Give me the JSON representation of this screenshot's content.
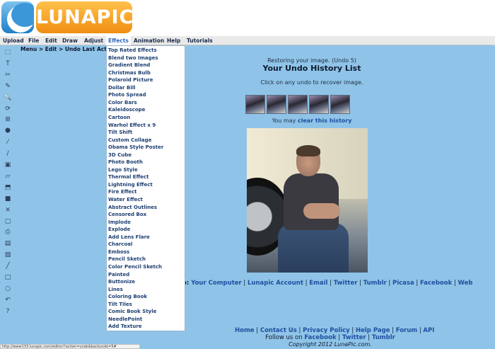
{
  "logo": {
    "text": "LUNAPIC"
  },
  "menubar": {
    "items": [
      {
        "label": "Upload"
      },
      {
        "label": "File"
      },
      {
        "label": "Edit"
      },
      {
        "label": "Draw"
      },
      {
        "label": "Adjust"
      },
      {
        "label": "Effects"
      },
      {
        "label": "Animation"
      },
      {
        "label": "Help"
      },
      {
        "label": "Tutorials"
      }
    ],
    "active": "Effects"
  },
  "breadcrumb": "Menu > Edit > Undo Last Action",
  "toolbar": {
    "icons": [
      "select-icon",
      "text-icon",
      "scissors-icon",
      "pencil-icon",
      "zoom-icon",
      "rotate-icon",
      "crop-icon",
      "paint-bucket-icon",
      "eyedropper-icon",
      "brush-icon",
      "image-icon",
      "eraser-icon",
      "open-icon",
      "save-icon",
      "close-icon",
      "new-icon",
      "print-icon",
      "layers-icon",
      "copy-icon",
      "line-icon",
      "rectangle-icon",
      "circle-icon",
      "undo-icon",
      "help-icon"
    ],
    "glyphs": [
      "⬚",
      "T",
      "✂",
      "✎",
      "🔍",
      "⟳",
      "⊞",
      "⬢",
      "⁄",
      "∕",
      "▣",
      "▱",
      "⬒",
      "■",
      "✕",
      "▢",
      "⎙",
      "▤",
      "▧",
      "╱",
      "□",
      "○",
      "↶",
      "?"
    ]
  },
  "effects_menu": [
    "Top Rated Effects",
    "Blend two Images",
    "Gradient Blend",
    "Christmas Bulb",
    "Polaroid Picture",
    "Dollar Bill",
    "Photo Spread",
    "Color Bars",
    "Kaleidoscope",
    "Cartoon",
    "Warhol Effect x 9",
    "Tilt Shift",
    "Custom Collage",
    "Obama Style Poster",
    "3D Cube",
    "Photo Booth",
    "Lego Style",
    "Thermal Effect",
    "Lightning Effect",
    "Fire Effect",
    "Water Effect",
    "Abstract Outlines",
    "Censored Box",
    "Implode",
    "Explode",
    "Add Lens Flare",
    "Charcoal",
    "Emboss",
    "Pencil Sketch",
    "Color Pencil Sketch",
    "Painted",
    "Buttonize",
    "Lines",
    "Coloring Book",
    "Tilt Tiles",
    "Comic Book Style",
    "NeedlePoint",
    "Add Texture"
  ],
  "main": {
    "status": "Restoring your image. (Undo 5)",
    "title": "Your Undo History List",
    "instruction": "Click on any undo to recover image.",
    "clear_prefix": "You may ",
    "clear_link": "clear this history",
    "thumbnail_count": 5
  },
  "upload_line": {
    "prefix": "o: ",
    "links": [
      "Your Computer",
      "Lunapic Account",
      "Email",
      "Twitter",
      "Tumblr",
      "Picasa",
      "Facebook",
      "Web"
    ]
  },
  "footer": {
    "links": [
      "Home",
      "Contact Us",
      "Privacy Policy",
      "Help Page",
      "Forum",
      "API"
    ],
    "follow_prefix": "Follow us on ",
    "follow_links": [
      "Facebook",
      "Twitter",
      "Tumblr"
    ],
    "copyright": "Copyright 2012 LunaPic.com."
  },
  "statusbar": "http://www133.lunapic.com/editor/?action=undo&backundo=5#"
}
